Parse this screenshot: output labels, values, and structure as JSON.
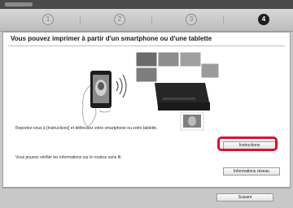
{
  "steps": [
    "1",
    "2",
    "3",
    "4"
  ],
  "active_step": 4,
  "heading": "Vous pouvez imprimer à partir d'un smartphone ou d'une tablette",
  "instruction_note": "Reportez-vous à [Instructions] et définissez votre smartphone ou votre tablette.",
  "router_note": "Vous pouvez vérifier les informations sur le routeur sans fil.",
  "buttons": {
    "instructions": "Instructions",
    "network_info": "Informations réseau",
    "next": "Suivant"
  },
  "colors": {
    "highlight": "#e0102a",
    "active_step": "#1e1e1e"
  }
}
